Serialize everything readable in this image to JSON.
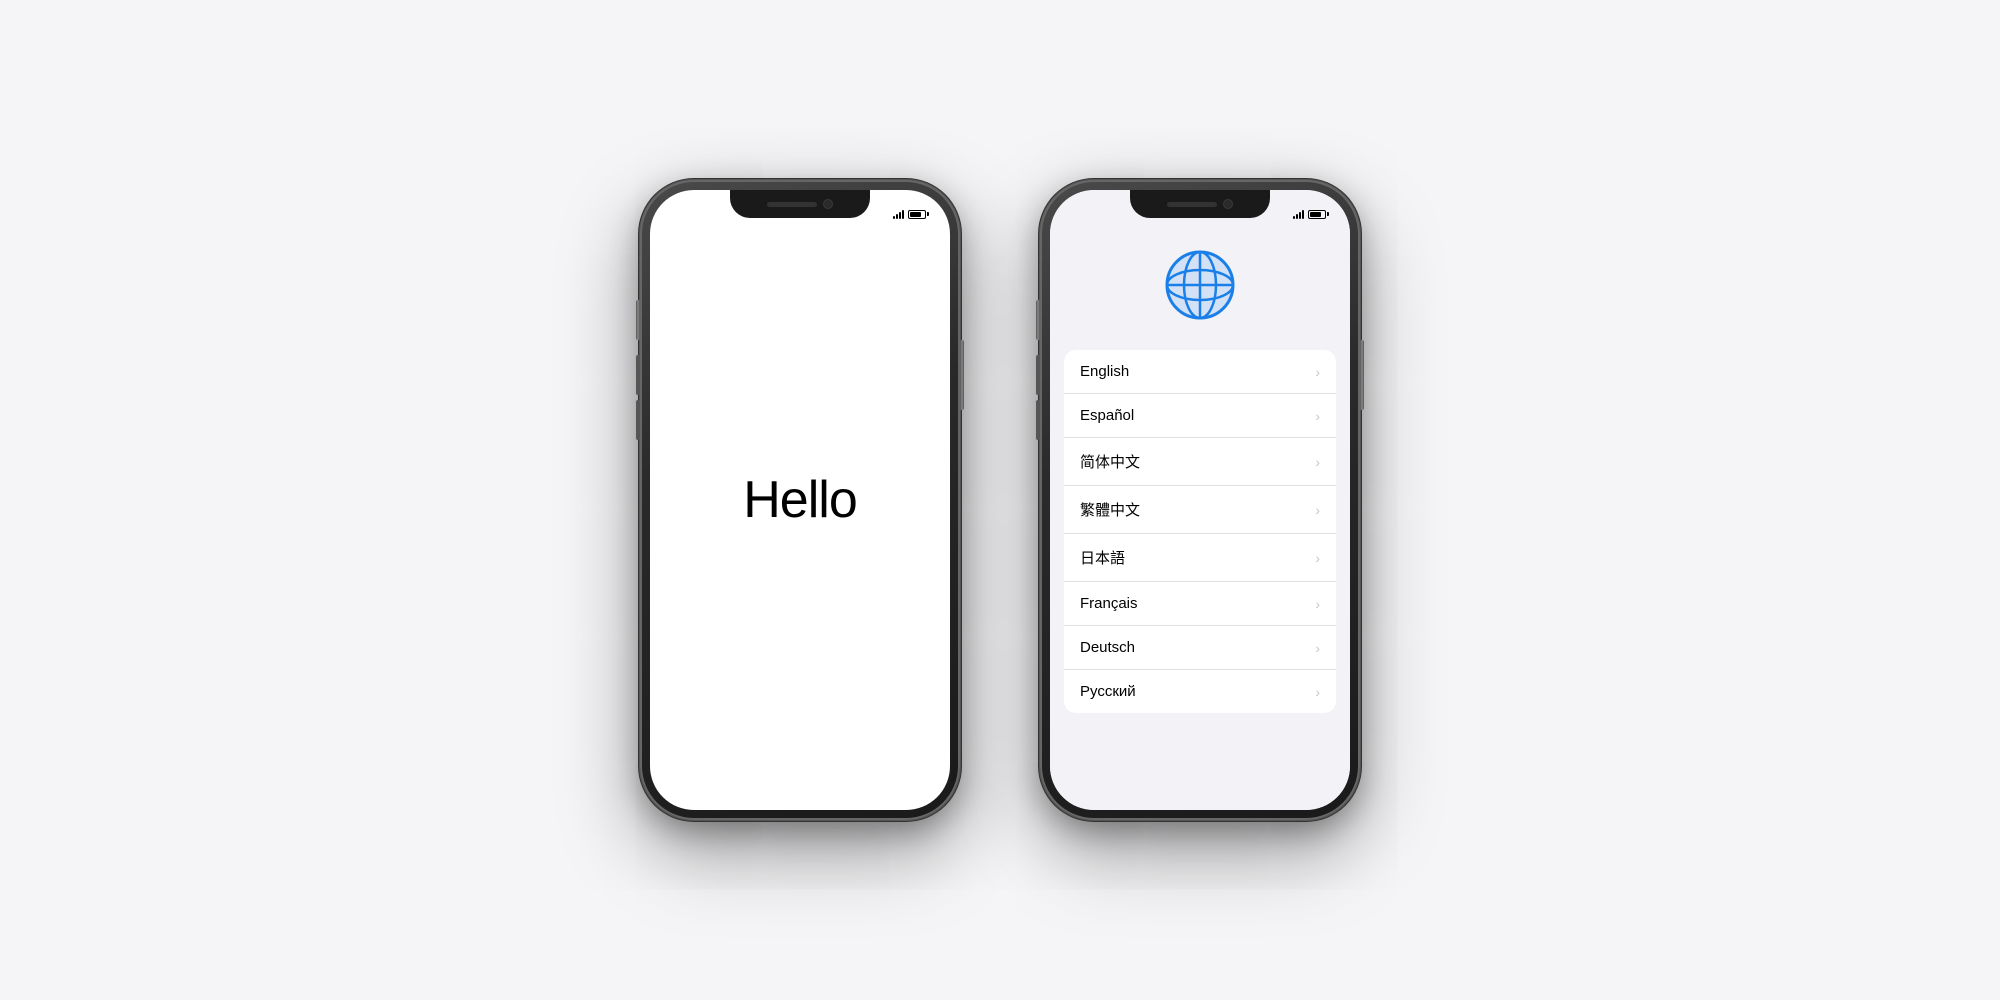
{
  "phones": {
    "hello_phone": {
      "status_bar": {
        "signal_label": "signal",
        "battery_label": "battery"
      },
      "hello_text": "Hello"
    },
    "language_phone": {
      "status_bar": {
        "signal_label": "signal",
        "battery_label": "battery"
      },
      "globe_icon": "globe",
      "languages": [
        {
          "label": "English",
          "id": "english"
        },
        {
          "label": "Español",
          "id": "espanol"
        },
        {
          "label": "简体中文",
          "id": "simplified-chinese"
        },
        {
          "label": "繁體中文",
          "id": "traditional-chinese"
        },
        {
          "label": "日本語",
          "id": "japanese"
        },
        {
          "label": "Français",
          "id": "french"
        },
        {
          "label": "Deutsch",
          "id": "german"
        },
        {
          "label": "Русский",
          "id": "russian"
        }
      ],
      "chevron": "›"
    }
  }
}
